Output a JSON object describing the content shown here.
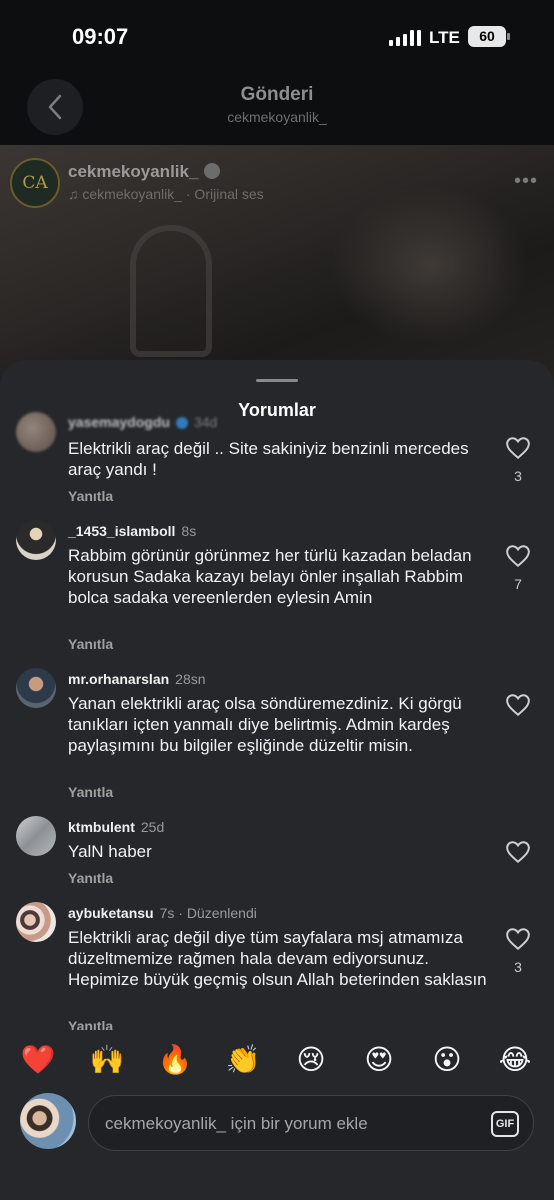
{
  "status_bar": {
    "time": "09:07",
    "network": "LTE",
    "battery": "60"
  },
  "header": {
    "title": "Gönderi",
    "subtitle": "cekmekoyanlik_"
  },
  "post": {
    "username": "cekmekoyanlik_",
    "audio": "cekmekoyanlik_ · Orijinal ses",
    "avatar_initials": "CA"
  },
  "comments_sheet": {
    "title": "Yorumlar",
    "comments": [
      {
        "username": "yasemaydogdu",
        "meta": "34d",
        "text": "Elektrikli araç değil .. Site sakiniyiz benzinli mercedes araç yandı !",
        "reply": "Yanıtla",
        "likes": "3"
      },
      {
        "username": "_1453_islamboll",
        "meta": "8s",
        "text": "Rabbim görünür görünmez her türlü kazadan beladan korusun Sadaka kazayı belayı önler inşallah Rabbim bolca sadaka vereenlerden eylesin Amin",
        "reply": "Yanıtla",
        "likes": "7"
      },
      {
        "username": "mr.orhanarslan",
        "meta": "28sn",
        "text": "Yanan elektrikli araç olsa söndüremezdiniz. Ki görgü tanıkları içten yanmalı diye belirtmiş. Admin kardeş paylaşımını bu bilgiler eşliğinde düzeltir misin.",
        "reply": "Yanıtla",
        "likes": ""
      },
      {
        "username": "ktmbulent",
        "meta": "25d",
        "text": "YalN haber",
        "reply": "Yanıtla",
        "likes": ""
      },
      {
        "username": "aybuketansu",
        "meta": "7s · Düzenlendi",
        "text": "Elektrikli araç değil diye tüm sayfalara msj atmamıza düzeltmemize rağmen hala devam ediyorsunuz. Hepimize büyük geçmiş olsun Allah beterinden saklasın",
        "reply": "Yanıtla",
        "likes": "3"
      }
    ]
  },
  "reactions": [
    "❤️",
    "🙌",
    "🔥",
    "👏",
    "😢",
    "😍",
    "😮",
    "😂"
  ],
  "composer": {
    "placeholder": "cekmekoyanlik_ için bir yorum ekle",
    "gif_label": "GIF"
  },
  "colors": {
    "sheet_bg": "#25272b",
    "heart_red": "#e0263a",
    "verified_blue": "#3897f0"
  }
}
